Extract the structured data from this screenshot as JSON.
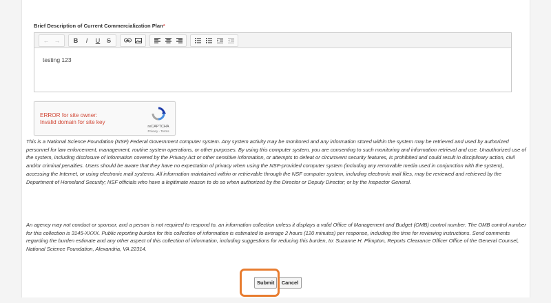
{
  "form": {
    "field_label": "Brief Description of Current Commercialization Plan",
    "required_mark": "*",
    "editor_value": "testing 123",
    "toolbar": [
      "undo-icon",
      "redo-icon",
      "bold-icon",
      "italic-icon",
      "underline-icon",
      "strikethrough-icon",
      "link-icon",
      "image-icon",
      "align-left-icon",
      "align-center-icon",
      "align-right-icon",
      "bullet-list-icon",
      "numbered-list-icon",
      "indent-icon",
      "outdent-icon"
    ]
  },
  "recaptcha": {
    "error_line1": "ERROR for site owner:",
    "error_line2": "Invalid domain for site key",
    "brand": "reCAPTCHA",
    "terms": "Privacy - Terms"
  },
  "notice": {
    "paragraph1": "This is a National Science Foundation (NSF) Federal Government computer system. Any system activity may be monitored and any information stored within the system may be retrieved and used by authorized personnel for law enforcement, management, routine system operations, or other purposes. By using this computer system, you are consenting to such monitoring and information retrieval and use. Unauthorized use of the system, including disclosure of information covered by the Privacy Act or other sensitive information, or attempts to defeat or circumvent security features, is prohibited and could result in disciplinary action, civil and/or criminal penalties. Users should be aware that they have no expectation of privacy when using the NSF-provided computer system (including any removable media used in conjunction with the system), accessing the Internet, or using electronic mail systems. All information maintained within or retrievable through the NSF computer system, including electronic mail files, may be reviewed and retrieved by the Department of Homeland Security; NSF officials who have a legitimate reason to do so when authorized by the Director or Deputy Director; or by the Inspector General.",
    "paragraph2": "An agency may not conduct or sponsor, and a person is not required to respond to, an information collection unless it displays a valid Office of Management and Budget (OMB) control number. The OMB control number for this collection is 3145-XXXX. Public reporting burden for this collection of information is estimated to average 2 hours (120 minutes) per response, including the time for reviewing instructions. Send comments regarding the burden estimate and any other aspect of this collection of information, including suggestions for reducing this burden, to: Suzanne H. Plimpton, Reports Clearance Officer Office of the General Counsel, National Science Foundation, Alexandria, VA 22314."
  },
  "actions": {
    "submit_label": "Submit",
    "cancel_label": "Cancel"
  },
  "colors": {
    "highlight": "#e87c2f",
    "error": "#d14836",
    "required": "#d9534f"
  }
}
